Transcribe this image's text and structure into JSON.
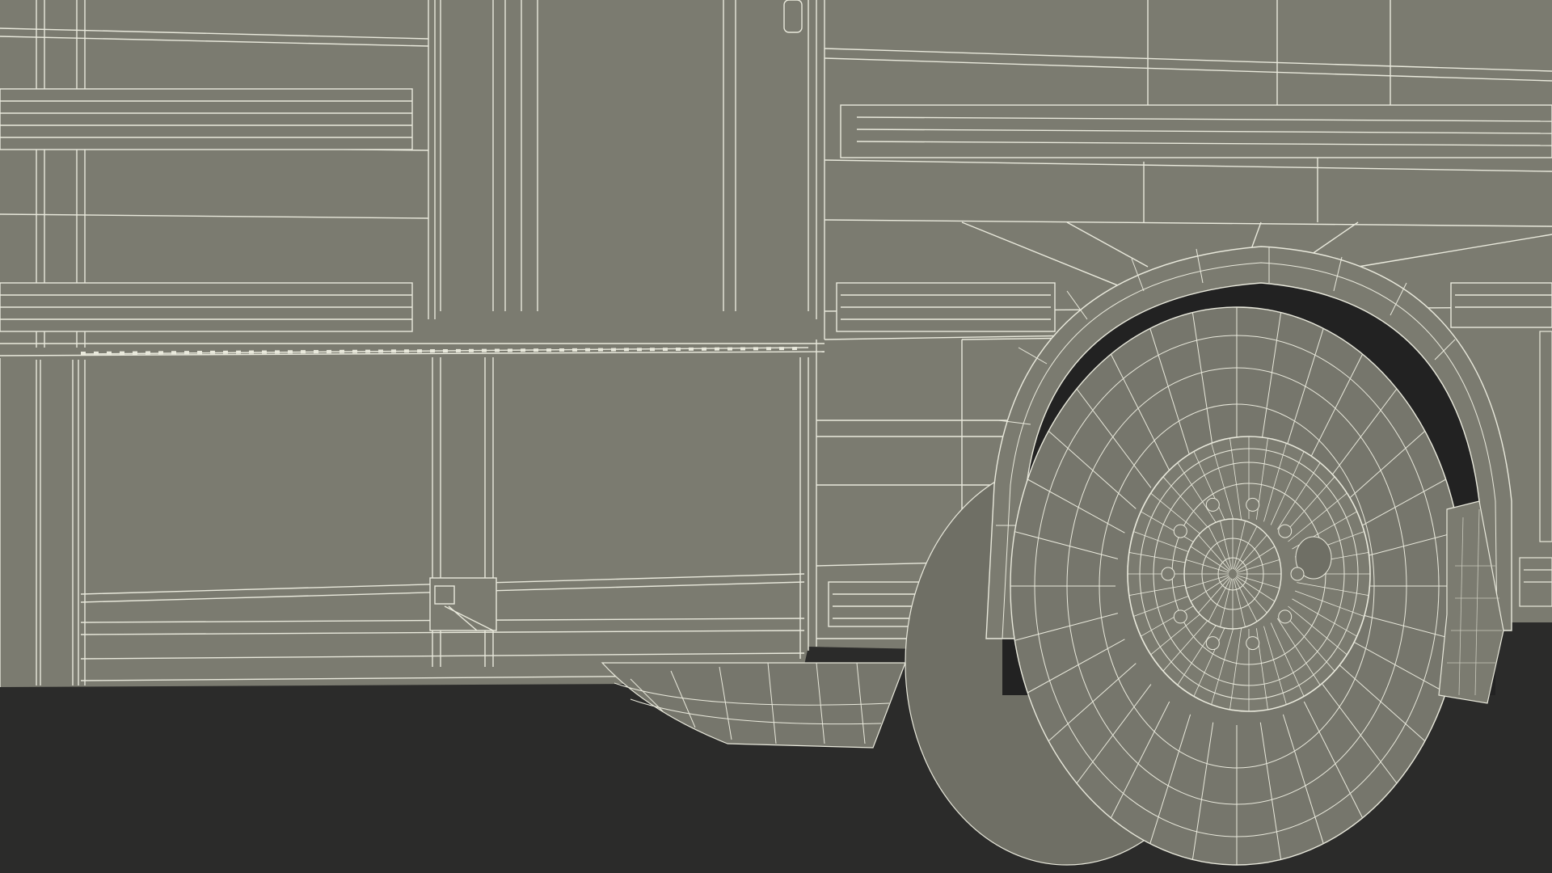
{
  "scene": {
    "subject": "truck-body-wireframe-render",
    "colors": {
      "body": "#7b7b70",
      "body_shade": "#6f6f65",
      "wire": "#e9e9dc",
      "wire_dim": "#c9c9bc",
      "ground": "#2b2b2a",
      "tire": "#76766c",
      "tire_shadow": "#64645b",
      "wheel_well": "#222222"
    }
  }
}
